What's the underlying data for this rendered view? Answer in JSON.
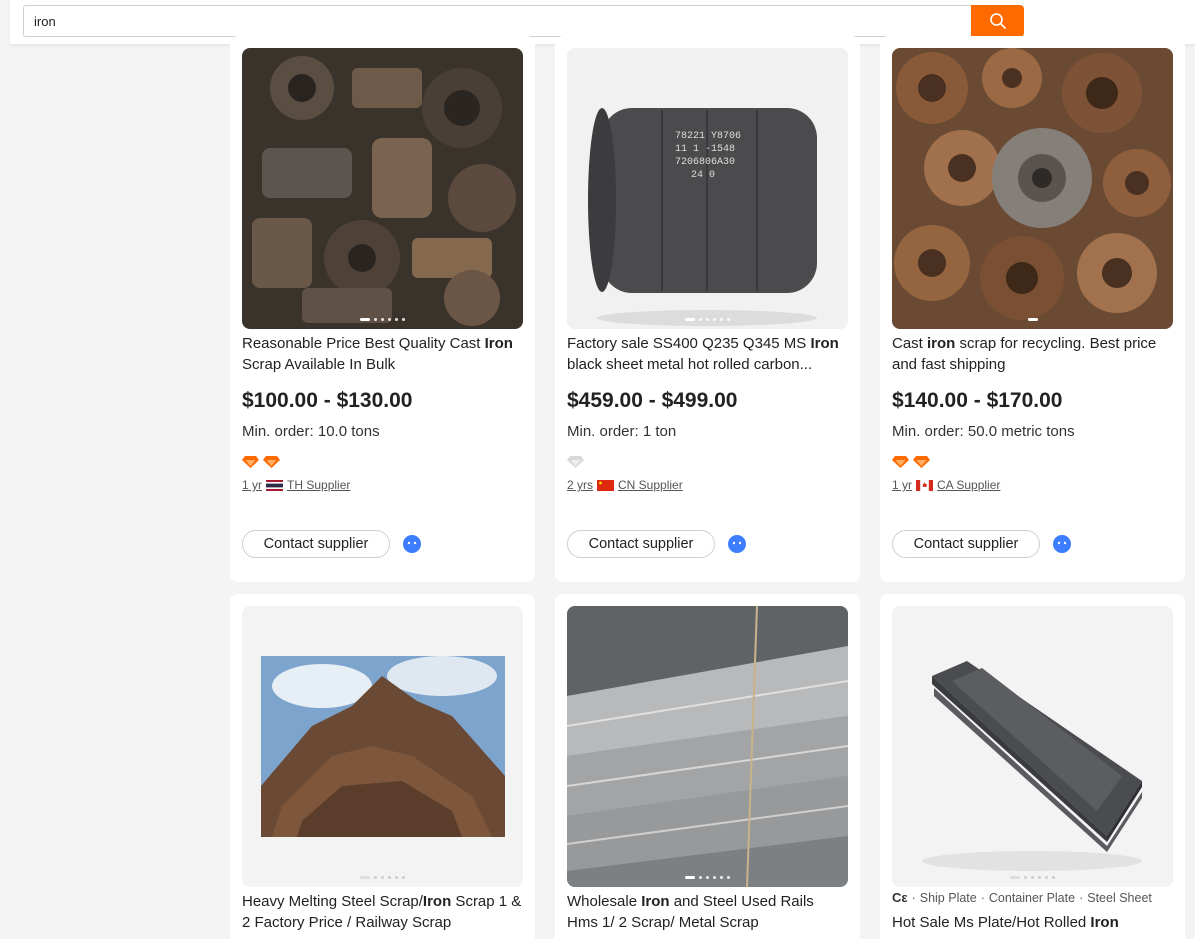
{
  "search": {
    "value": "iron"
  },
  "colors": {
    "accent": "#ff6a00",
    "chat": "#3d7dff",
    "gem": "#ff6a00"
  },
  "products": [
    {
      "title_pre": "Reasonable Price Best Quality Cast ",
      "title_hl": "Iron",
      "title_post": " Scrap Available In Bulk",
      "price": "$100.00 - $130.00",
      "moq": "Min. order: 10.0 tons",
      "years": "1 yr",
      "supplier": "TH Supplier",
      "contact": "Contact supplier",
      "image_icon": "cast-iron-scrap-pile"
    },
    {
      "title_pre": "Factory sale SS400 Q235 Q345 MS ",
      "title_hl": "Iron",
      "title_post": " black sheet metal hot rolled carbon...",
      "price": "$459.00 - $499.00",
      "moq": "Min. order: 1 ton",
      "years": "2 yrs",
      "supplier": "CN Supplier",
      "contact": "Contact supplier",
      "image_icon": "steel-coil"
    },
    {
      "title_pre": "Cast ",
      "title_hl": "iron",
      "title_post": " scrap for recycling. Best price and fast shipping",
      "price": "$140.00 - $170.00",
      "moq": "Min. order: 50.0 metric tons",
      "years": "1 yr",
      "supplier": "CA Supplier",
      "contact": "Contact supplier",
      "image_icon": "brake-disc-scrap"
    },
    {
      "title_pre": "Heavy Melting Steel Scrap/",
      "title_hl": "Iron",
      "title_post": " Scrap 1 & 2 Factory Price / Railway Scrap",
      "image_icon": "scrap-heap"
    },
    {
      "title_pre": "Wholesale ",
      "title_hl": "Iron",
      "title_post": " and Steel Used Rails Hms 1/ 2 Scrap/ Metal Scrap",
      "image_icon": "stacked-rails"
    },
    {
      "tags": [
        "Ship Plate",
        "Container Plate",
        "Steel Sheet"
      ],
      "title_pre": "Hot Sale Ms Plate/Hot Rolled ",
      "title_hl": "Iron",
      "title_post": "",
      "image_icon": "steel-plate-stack"
    }
  ]
}
